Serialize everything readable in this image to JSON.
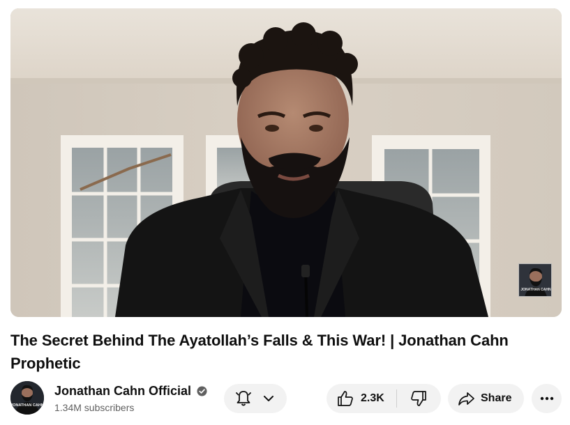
{
  "video": {
    "player_icon": "video-frame",
    "watermark_text": "JONATHAN CAHN",
    "colors": {
      "wall": "#d8cfc2",
      "ceiling": "#ece6dd",
      "jacket": "#141414"
    }
  },
  "title": "The Secret Behind The Ayatollah’s Falls & This War! | Jonathan Cahn Prophetic",
  "channel": {
    "name": "Jonathan Cahn Official",
    "verified_icon": "verified-check-icon",
    "subscribers": "1.34M subscribers",
    "avatar_text": "JONATHAN CAHN"
  },
  "actions": {
    "bell_icon": "bell-icon",
    "chevron_icon": "chevron-down-icon",
    "like_count": "2.3K",
    "like_icon": "thumbs-up-icon",
    "dislike_icon": "thumbs-down-icon",
    "share_label": "Share",
    "share_icon": "share-arrow-icon",
    "more_icon": "more-horizontal-icon"
  },
  "colors": {
    "pill_bg": "#f2f2f2",
    "text_primary": "#0f0f0f",
    "text_secondary": "#606060"
  }
}
